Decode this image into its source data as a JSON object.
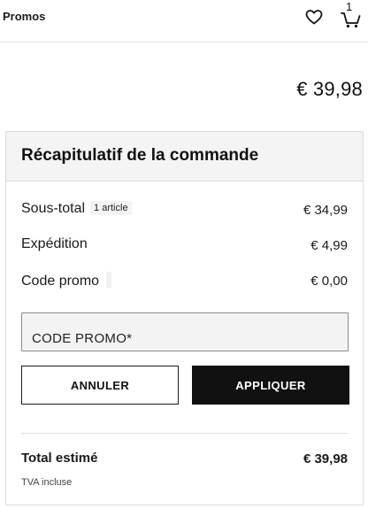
{
  "nav": {
    "title": "Promos",
    "cart_count": "1"
  },
  "header": {
    "total": "€ 39,98"
  },
  "summary": {
    "title": "Récapitulatif de la commande",
    "subtotal": {
      "label": "Sous-total",
      "badge": "1 article",
      "value": "€ 34,99"
    },
    "shipping": {
      "label": "Expédition",
      "value": "€ 4,99"
    },
    "promo": {
      "label": "Code promo",
      "value": "€ 0,00"
    },
    "promo_input": {
      "placeholder": "CODE PROMO*",
      "value": ""
    },
    "cancel_label": "ANNULER",
    "apply_label": "APPLIQUER",
    "total": {
      "label": "Total estimé",
      "value": "€ 39,98"
    },
    "tax_note": "TVA incluse"
  }
}
